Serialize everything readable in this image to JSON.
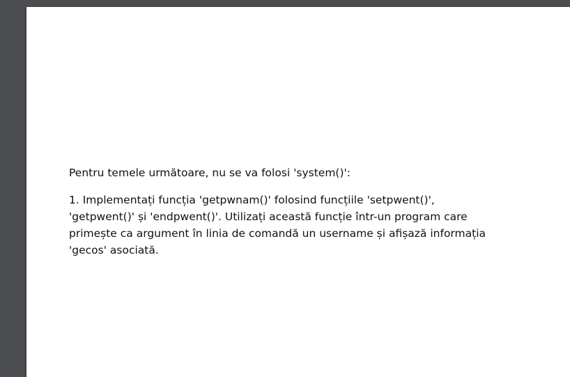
{
  "document": {
    "intro": "Pentru temele următoare, nu se va folosi 'system()':",
    "task1_lines": [
      "1. Implementați funcția 'getpwnam()' folosind funcțiile 'setpwent()',",
      "'getpwent()' și 'endpwent()'. Utilizați această funcție într-un program care",
      "primește ca argument în linia de comandă un username și afișază informația",
      "'gecos' asociată."
    ]
  },
  "colors": {
    "viewer_background": "#4b4d50",
    "page_background": "#ffffff",
    "text": "#111111"
  }
}
